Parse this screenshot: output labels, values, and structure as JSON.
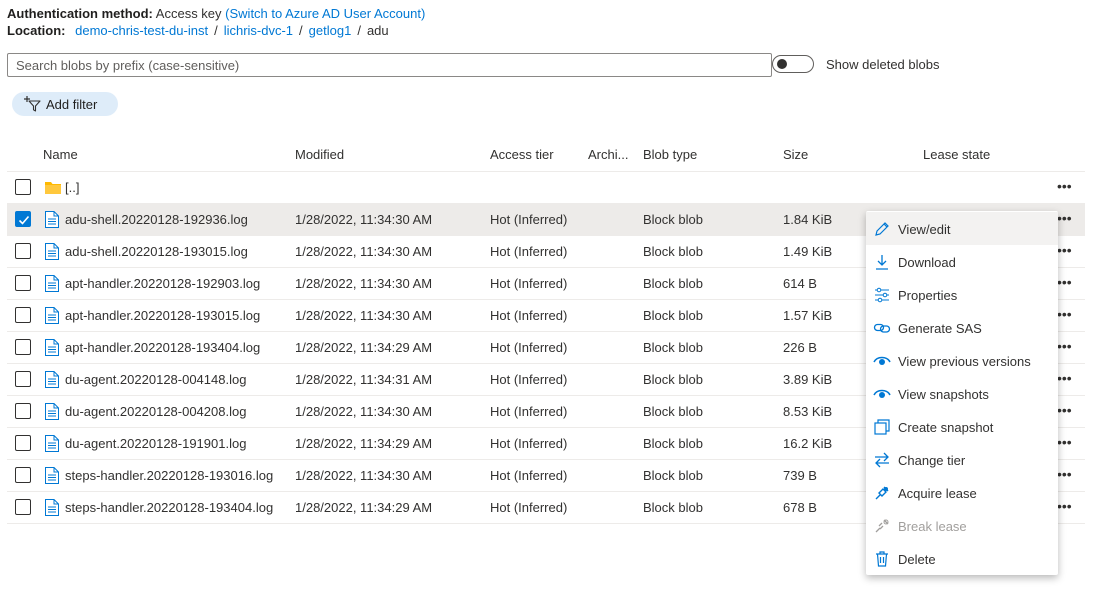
{
  "auth": {
    "label": "Authentication method:",
    "value": "Access key",
    "switch_link": "(Switch to Azure AD User Account)"
  },
  "location": {
    "label": "Location:",
    "breadcrumb": [
      "demo-chris-test-du-inst",
      "lichris-dvc-1",
      "getlog1",
      "adu"
    ],
    "separator": "/"
  },
  "search": {
    "placeholder": "Search blobs by prefix (case-sensitive)",
    "value": ""
  },
  "toggle": {
    "label": "Show deleted blobs",
    "on": false
  },
  "filter": {
    "add_label": "Add filter"
  },
  "table": {
    "columns": [
      "Name",
      "Modified",
      "Access tier",
      "Archi...",
      "Blob type",
      "Size",
      "Lease state"
    ],
    "parent_folder": "[..]",
    "rows": [
      {
        "name": "adu-shell.20220128-192936.log",
        "modified": "1/28/2022, 11:34:30 AM",
        "tier": "Hot (Inferred)",
        "archive": "",
        "type": "Block blob",
        "size": "1.84 KiB",
        "lease": "",
        "selected": true
      },
      {
        "name": "adu-shell.20220128-193015.log",
        "modified": "1/28/2022, 11:34:30 AM",
        "tier": "Hot (Inferred)",
        "archive": "",
        "type": "Block blob",
        "size": "1.49 KiB",
        "lease": "",
        "selected": false
      },
      {
        "name": "apt-handler.20220128-192903.log",
        "modified": "1/28/2022, 11:34:30 AM",
        "tier": "Hot (Inferred)",
        "archive": "",
        "type": "Block blob",
        "size": "614 B",
        "lease": "",
        "selected": false
      },
      {
        "name": "apt-handler.20220128-193015.log",
        "modified": "1/28/2022, 11:34:30 AM",
        "tier": "Hot (Inferred)",
        "archive": "",
        "type": "Block blob",
        "size": "1.57 KiB",
        "lease": "",
        "selected": false
      },
      {
        "name": "apt-handler.20220128-193404.log",
        "modified": "1/28/2022, 11:34:29 AM",
        "tier": "Hot (Inferred)",
        "archive": "",
        "type": "Block blob",
        "size": "226 B",
        "lease": "",
        "selected": false
      },
      {
        "name": "du-agent.20220128-004148.log",
        "modified": "1/28/2022, 11:34:31 AM",
        "tier": "Hot (Inferred)",
        "archive": "",
        "type": "Block blob",
        "size": "3.89 KiB",
        "lease": "",
        "selected": false
      },
      {
        "name": "du-agent.20220128-004208.log",
        "modified": "1/28/2022, 11:34:30 AM",
        "tier": "Hot (Inferred)",
        "archive": "",
        "type": "Block blob",
        "size": "8.53 KiB",
        "lease": "",
        "selected": false
      },
      {
        "name": "du-agent.20220128-191901.log",
        "modified": "1/28/2022, 11:34:29 AM",
        "tier": "Hot (Inferred)",
        "archive": "",
        "type": "Block blob",
        "size": "16.2 KiB",
        "lease": "",
        "selected": false
      },
      {
        "name": "steps-handler.20220128-193016.log",
        "modified": "1/28/2022, 11:34:30 AM",
        "tier": "Hot (Inferred)",
        "archive": "",
        "type": "Block blob",
        "size": "739 B",
        "lease": "",
        "selected": false
      },
      {
        "name": "steps-handler.20220128-193404.log",
        "modified": "1/28/2022, 11:34:29 AM",
        "tier": "Hot (Inferred)",
        "archive": "",
        "type": "Block blob",
        "size": "678 B",
        "lease": "",
        "selected": false
      }
    ]
  },
  "context_menu": {
    "items": [
      {
        "label": "View/edit",
        "icon": "pencil-icon",
        "disabled": false
      },
      {
        "label": "Download",
        "icon": "download-icon",
        "disabled": false
      },
      {
        "label": "Properties",
        "icon": "properties-icon",
        "disabled": false
      },
      {
        "label": "Generate SAS",
        "icon": "link-icon",
        "disabled": false
      },
      {
        "label": "View previous versions",
        "icon": "eye-icon",
        "disabled": false
      },
      {
        "label": "View snapshots",
        "icon": "eye-icon",
        "disabled": false
      },
      {
        "label": "Create snapshot",
        "icon": "snapshot-icon",
        "disabled": false
      },
      {
        "label": "Change tier",
        "icon": "swap-icon",
        "disabled": false
      },
      {
        "label": "Acquire lease",
        "icon": "lease-icon",
        "disabled": false
      },
      {
        "label": "Break lease",
        "icon": "break-lease-icon",
        "disabled": true
      },
      {
        "label": "Delete",
        "icon": "trash-icon",
        "disabled": false
      }
    ]
  },
  "colors": {
    "accent": "#0078d4",
    "folder": "#ffb900",
    "selected_row": "#edebe9",
    "filter_pill": "#deecf9"
  }
}
